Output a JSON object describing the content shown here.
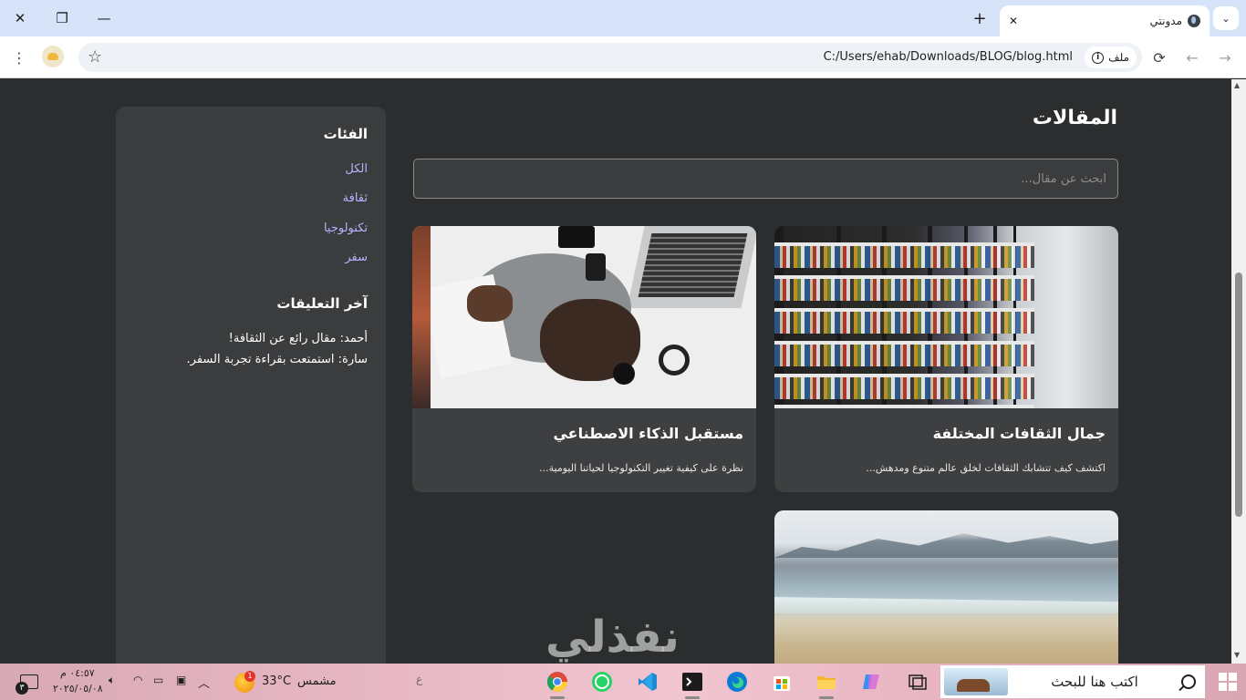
{
  "browser": {
    "tab_title": "مدونتي",
    "tab_close": "✕",
    "new_tab": "+",
    "tab_search": "⌄",
    "window_close": "✕",
    "window_restore": "❐",
    "window_minimize": "—",
    "url": "C:/Users/ehab/Downloads/BLOG/blog.html",
    "site_chip_label": "ملف",
    "back": "←",
    "forward": "→",
    "reload": "⟳",
    "menu": "⋮"
  },
  "main": {
    "title": "المقالات",
    "search_placeholder": "ابحث عن مقال...",
    "articles": [
      {
        "title": "جمال الثقافات المختلفة",
        "excerpt": "اكتشف كيف تتشابك الثقافات لخلق عالم متنوع ومدهش...",
        "image": "library-photo"
      },
      {
        "title": "مستقبل الذكاء الاصطناعي",
        "excerpt": "نظرة على كيفية تغيير التكنولوجيا لحياتنا اليومية...",
        "image": "desk-photo"
      },
      {
        "title": "",
        "excerpt": "",
        "image": "beach-photo"
      }
    ]
  },
  "sidebar": {
    "categories_title": "الفئات",
    "categories": [
      "الكل",
      "ثقافة",
      "تكنولوجيا",
      "سفر"
    ],
    "comments_title": "آخر التعليقات",
    "comments": [
      "أحمد: مقال رائع عن الثقافة!",
      "سارة: استمتعت بقراءة تجربة السفر."
    ]
  },
  "watermark": "نفذلي",
  "taskbar": {
    "search_placeholder": "اكتب هنا للبحث",
    "weather_temp": "33°C",
    "weather_desc": "مشمس",
    "weather_badge": "1",
    "time": "٠٤:٥٧ م",
    "date": "٢٠٢٥/٠٥/٠٨",
    "notification_count": "٣",
    "apps": [
      "chrome-icon",
      "whatsapp-icon",
      "vscode-icon",
      "terminal-icon",
      "edge-icon",
      "store-icon",
      "file-explorer-icon",
      "copilot-icon",
      "task-view-icon"
    ]
  }
}
